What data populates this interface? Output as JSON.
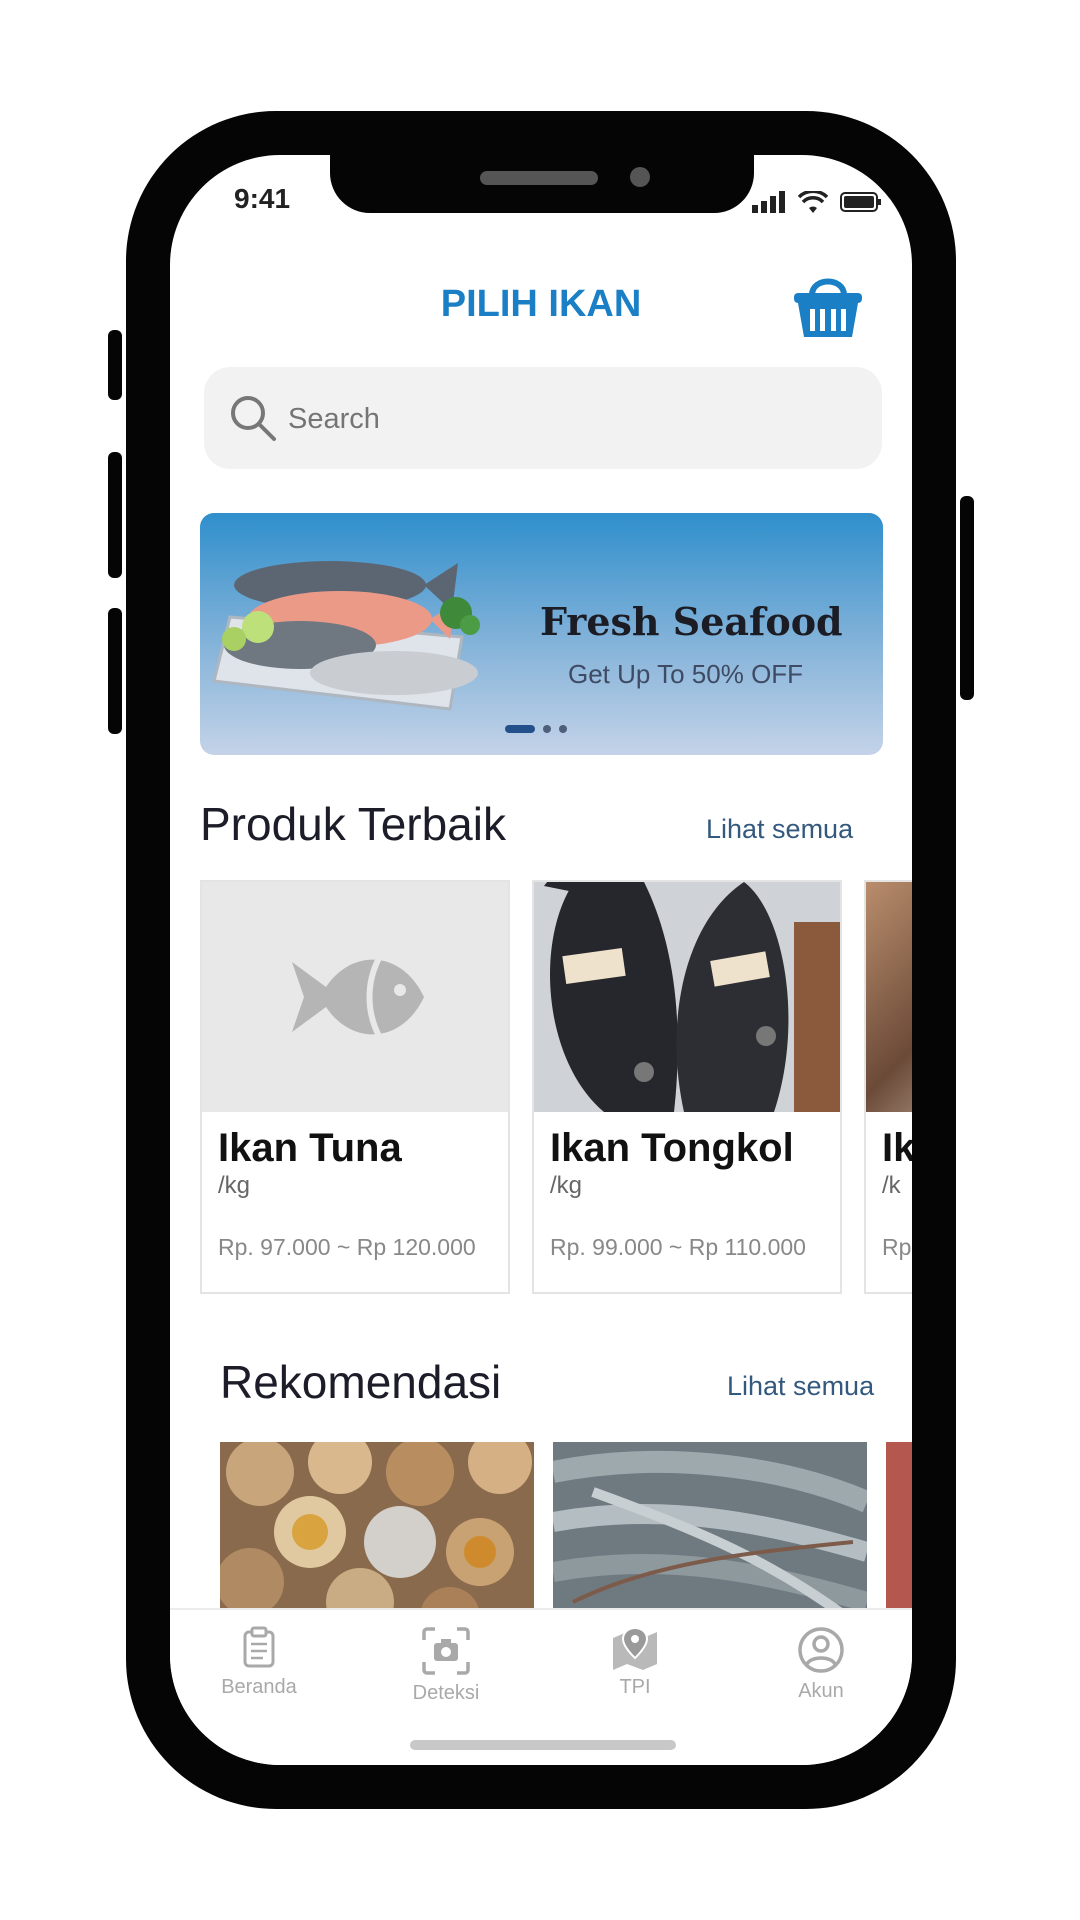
{
  "status_bar": {
    "time": "9:41"
  },
  "header": {
    "title": "PILIH IKAN",
    "cart_icon": "shopping-basket-icon"
  },
  "search": {
    "placeholder": "Search",
    "icon": "search-icon"
  },
  "banner": {
    "title": "Fresh Seafood",
    "subtitle": "Get Up To 50% OFF",
    "slide_count": 3,
    "active_slide": 1
  },
  "best_products": {
    "title": "Produk Terbaik",
    "see_all": "Lihat semua",
    "items": [
      {
        "name": "Ikan Tuna",
        "unit": "/kg",
        "price": "Rp. 97.000 ~ Rp 120.000"
      },
      {
        "name": "Ikan Tongkol",
        "unit": "/kg",
        "price": "Rp. 99.000 ~ Rp 110.000"
      },
      {
        "name": "Ik",
        "unit": "/k",
        "price": "Rp"
      }
    ]
  },
  "recommendations": {
    "title": "Rekomendasi",
    "see_all": "Lihat semua"
  },
  "bottom_nav": [
    {
      "label": "Beranda",
      "icon": "clipboard-icon"
    },
    {
      "label": "Deteksi",
      "icon": "camera-scan-icon"
    },
    {
      "label": "TPI",
      "icon": "map-pin-icon"
    },
    {
      "label": "Akun",
      "icon": "user-circle-icon"
    }
  ],
  "colors": {
    "accent": "#1b7fc6",
    "link": "#33597f",
    "text": "#1d1d2a"
  }
}
